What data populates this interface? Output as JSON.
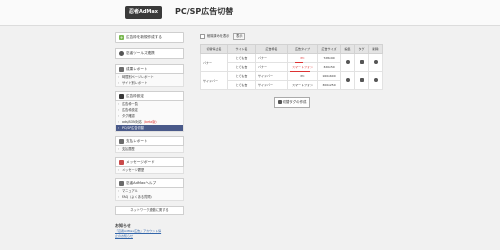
{
  "header": {
    "logo": "忍者AdMax",
    "title": "PC/SP広告切替"
  },
  "sidebar": {
    "create_label": "広告枠を新規作成する",
    "tool_label": "忍者ツールズ連携",
    "sections": [
      {
        "title": "成果レポート",
        "icon_color": "#6b6b6b",
        "items": [
          "時間別ページレポート",
          "サイト別レポート"
        ]
      },
      {
        "title": "広告枠設定",
        "icon_color": "#3a3a3a",
        "items": [
          "広告枠一覧",
          "広告枠設定",
          "タグ確認",
          "adsJSON対応",
          "PC/SP広告切替"
        ],
        "active_index": 4,
        "item3_suffix": "（beta版）"
      },
      {
        "title": "支払レポート",
        "icon_color": "#6b6b6b",
        "items": [
          "支払履歴"
        ]
      },
      {
        "title": "メッセージボード",
        "icon_color": "#c94a4a",
        "items": [
          "メッセージ履歴"
        ]
      },
      {
        "title": "忍者AdMaxヘルプ",
        "icon_color": "#6b6b6b",
        "items": [
          "マニュアル",
          "FAQ（よくある質問）"
        ]
      }
    ],
    "chip_label": "ネットワーク連動に関する",
    "notice_title": "お知らせ",
    "notice_links": [
      "「忍者AdMax広告」アカウント停",
      "止のお知らせ"
    ]
  },
  "main": {
    "checkbox_label": "削除済みを表示",
    "show_button": "表示",
    "columns": [
      "切替停止名",
      "サイト名",
      "広告枠名",
      "広告タイプ",
      "広告サイズ",
      "編集",
      "タグ",
      "削除"
    ],
    "rows": [
      {
        "switch_name": "バナー",
        "site": "とても吉",
        "slot": "バナー",
        "type": "PC",
        "size": "728x90"
      },
      {
        "switch_name": "",
        "site": "とても吉",
        "slot": "バナー",
        "type": "スマートフォン",
        "size": "320x50"
      },
      {
        "switch_name": "サイドバー",
        "site": "とても吉",
        "slot": "サイドバー",
        "type": "PC",
        "size": "160x600"
      },
      {
        "switch_name": "",
        "site": "とても吉",
        "slot": "サイドバー",
        "type": "スマートフォン",
        "size": "300x250"
      }
    ],
    "add_button": "切替タグの作成"
  }
}
